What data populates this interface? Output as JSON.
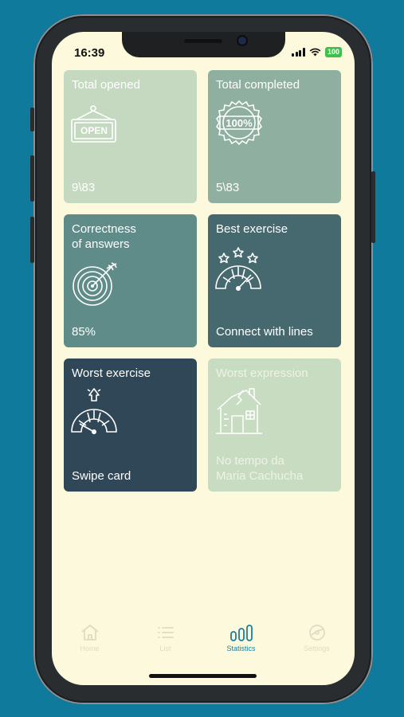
{
  "status": {
    "time": "16:39",
    "battery": "100"
  },
  "cards": [
    {
      "title": "Total opened",
      "value": "9\\83",
      "icon": "open-sign-icon",
      "color": "#c4d9c0",
      "text_color": "#ffffff"
    },
    {
      "title": "Total completed",
      "value": "5\\83",
      "icon": "100-percent-badge-icon",
      "color": "#8fb0a0",
      "text_color": "#ffffff"
    },
    {
      "title": "Correctness\nof answers",
      "value": "85%",
      "icon": "target-icon",
      "color": "#5f8c88",
      "text_color": "#ffffff"
    },
    {
      "title": "Best exercise",
      "value": "Connect with lines",
      "icon": "stars-gauge-icon",
      "color": "#46696f",
      "text_color": "#ffffff"
    },
    {
      "title": "Worst exercise",
      "value": "Swipe card",
      "icon": "low-gauge-icon",
      "color": "#2f4756",
      "text_color": "#ffffff"
    },
    {
      "title": "Worst expression",
      "value": "No tempo da\nMaria Cachucha",
      "icon": "broken-house-icon",
      "color": "#c8dcc2",
      "text_color": "#eef3e4"
    }
  ],
  "tabs": [
    {
      "label": "Home",
      "icon": "home-icon",
      "active": false
    },
    {
      "label": "List",
      "icon": "list-icon",
      "active": false
    },
    {
      "label": "Statistics",
      "icon": "bar-chart-icon",
      "active": true
    },
    {
      "label": "Settings",
      "icon": "gear-icon",
      "active": false
    }
  ],
  "colors": {
    "accent": "#1a7fa3",
    "inactive_tab": "#dfdcc4",
    "background": "#fdf9dc",
    "frame": "#0f7a9b"
  }
}
